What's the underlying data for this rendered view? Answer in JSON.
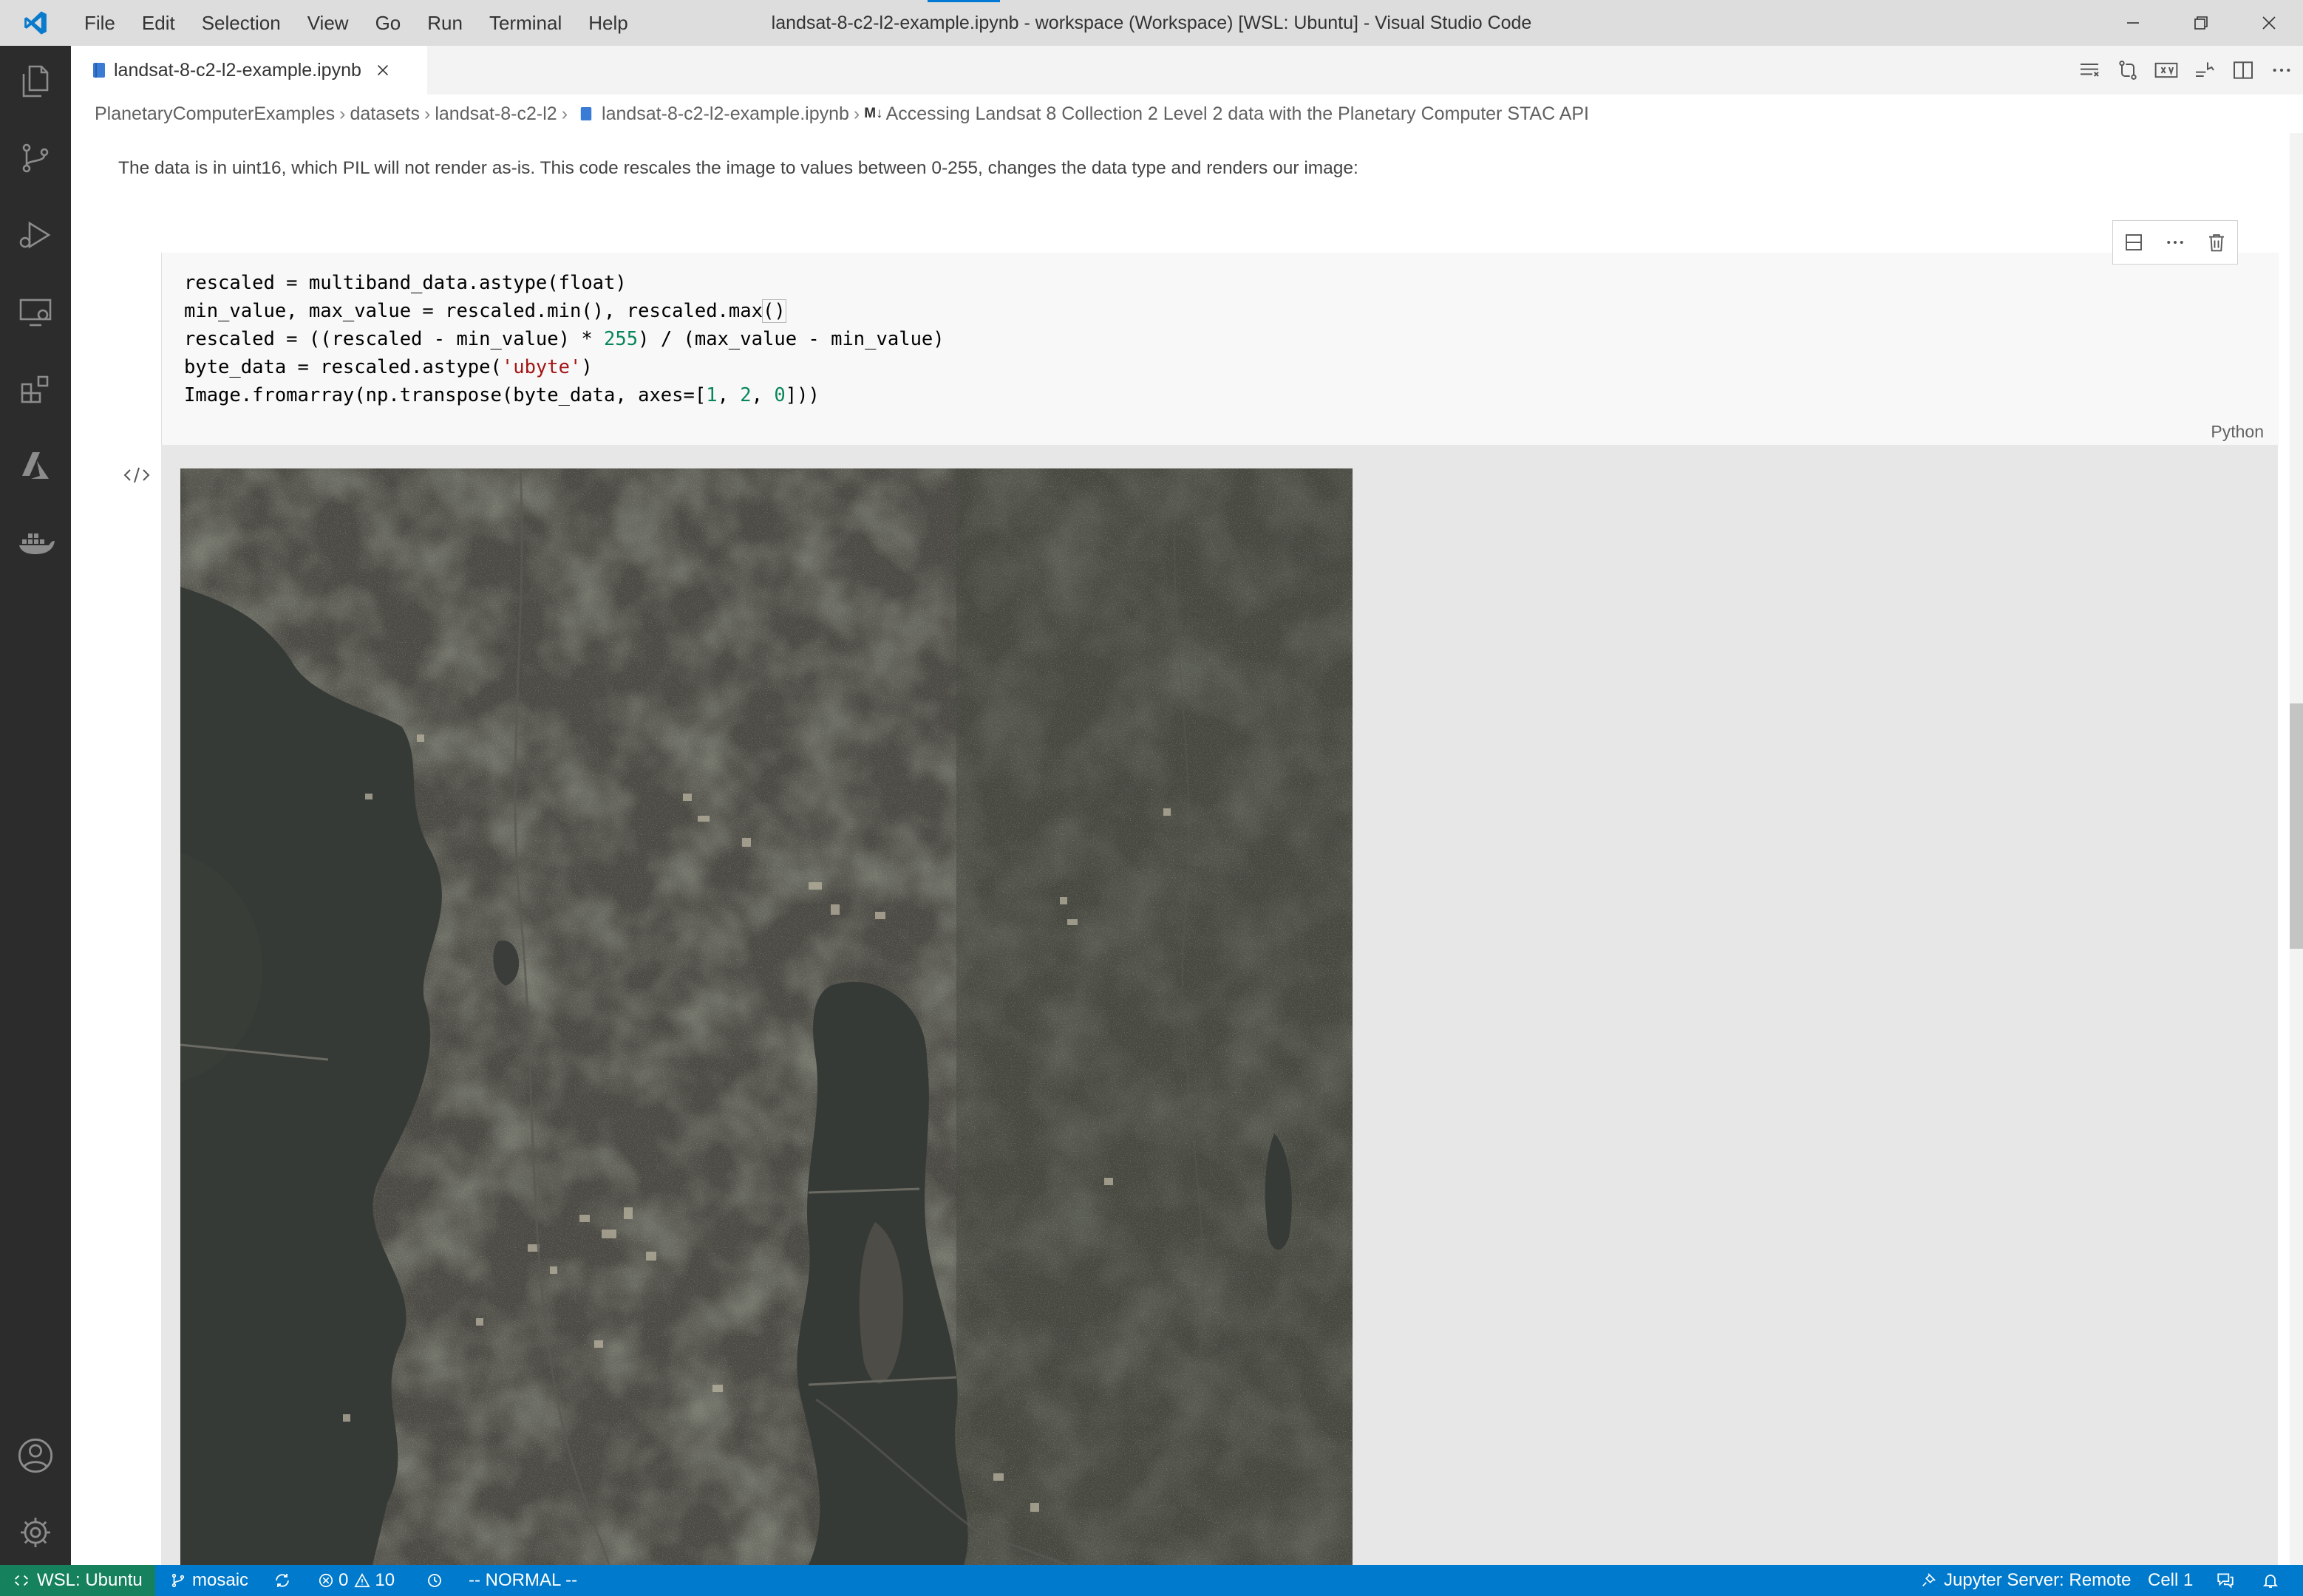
{
  "window": {
    "title": "landsat-8-c2-l2-example.ipynb - workspace (Workspace) [WSL: Ubuntu] - Visual Studio Code"
  },
  "menu": [
    "File",
    "Edit",
    "Selection",
    "View",
    "Go",
    "Run",
    "Terminal",
    "Help"
  ],
  "activity_bar": {
    "icons": [
      "explorer-icon",
      "source-control-icon",
      "run-debug-icon",
      "remote-explorer-icon",
      "extensions-icon",
      "azure-icon",
      "docker-icon",
      "accounts-icon",
      "settings-gear-icon"
    ]
  },
  "tab": {
    "label": "landsat-8-c2-l2-example.ipynb"
  },
  "breadcrumb": {
    "items": [
      "PlanetaryComputerExamples",
      "datasets",
      "landsat-8-c2-l2",
      "landsat-8-c2-l2-example.ipynb"
    ],
    "md_badge": "M↓",
    "section": "Accessing Landsat 8 Collection 2 Level 2 data with the Planetary Computer STAC API"
  },
  "markdown": {
    "text": "The data is in uint16, which PIL will not render as-is. This code rescales the image to values between 0-255, changes the data type and renders our image:"
  },
  "code_cell": {
    "language": "Python",
    "line1": "rescaled = multiband_data.astype(float)",
    "line2a": "min_value, max_value = rescaled.min(), rescaled.max",
    "line2b": "()",
    "line3a": "rescaled = ((rescaled - min_value) * ",
    "line3n": "255",
    "line3b": ") / (max_value - min_value)",
    "line4a": "byte_data = rescaled.astype(",
    "line4s": "'ubyte'",
    "line4b": ")",
    "line5a": "Image.fromarray(np.transpose(byte_data, axes=[",
    "line5n1": "1",
    "line5c1": ", ",
    "line5n2": "2",
    "line5c2": ", ",
    "line5n3": "0",
    "line5b": "]))"
  },
  "status": {
    "remote": "WSL: Ubuntu",
    "branch": "mosaic",
    "errors": "0",
    "warnings": "10",
    "vim_mode": "-- NORMAL --",
    "jupyter": "Jupyter Server: Remote",
    "cell": "Cell 1"
  },
  "colors": {
    "accent": "#0078d4",
    "statusbar": "#007acc",
    "activitybar": "#2c2c2c",
    "number_token": "#098658",
    "string_token": "#a31515"
  }
}
